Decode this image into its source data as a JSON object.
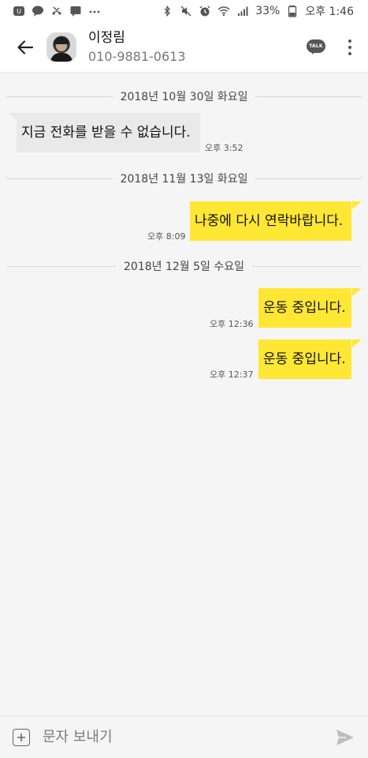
{
  "status_bar": {
    "left_icons": [
      "u-plus-icon",
      "talk-notification-icon",
      "missed-call-icon",
      "message-icon",
      "more-dots-icon"
    ],
    "right_icons": [
      "bluetooth-icon",
      "mute-icon",
      "alarm-icon",
      "wifi-icon",
      "signal-icon",
      "battery-icon"
    ],
    "battery": "33%",
    "time": "오후 1:46"
  },
  "header": {
    "contact_name": "이정림",
    "contact_number": "010-9881-0613",
    "talk_label": "TALK"
  },
  "conversation": {
    "dates": [
      "2018년 10월 30일 화요일",
      "2018년 11월 13일 화요일",
      "2018년 12월 5일 수요일"
    ],
    "messages": [
      {
        "direction": "incoming",
        "text": "지금 전화를 받을 수 없습니다.",
        "time": "오후 3:52"
      },
      {
        "direction": "outgoing",
        "text": "나중에 다시 연락바랍니다.",
        "time": "오후 8:09"
      },
      {
        "direction": "outgoing",
        "text": "운동 중입니다.",
        "time": "오후 12:36"
      },
      {
        "direction": "outgoing",
        "text": "운동 중입니다.",
        "time": "오후 12:37"
      }
    ]
  },
  "composer": {
    "placeholder": "문자 보내기"
  },
  "colors": {
    "outgoing_bubble": "#ffe733",
    "incoming_bubble": "#e9e9e9",
    "background": "#f5f5f5"
  }
}
